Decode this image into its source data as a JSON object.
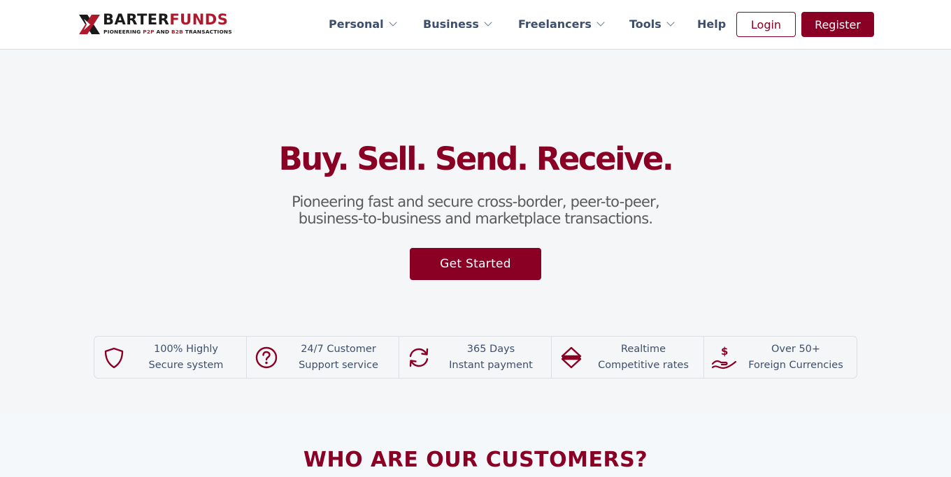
{
  "header": {
    "logo": {
      "word_part1": "BARTER",
      "word_part2": "FUNDS",
      "tagline_a": "PIONEERING ",
      "tagline_b": "P2P",
      "tagline_c": " AND ",
      "tagline_d": "B2B",
      "tagline_e": " TRANSACTIONS"
    },
    "nav": [
      {
        "label": "Personal",
        "has_dropdown": true
      },
      {
        "label": "Business",
        "has_dropdown": true
      },
      {
        "label": "Freelancers",
        "has_dropdown": true
      },
      {
        "label": "Tools",
        "has_dropdown": true
      },
      {
        "label": "Help",
        "has_dropdown": false
      }
    ],
    "login_label": "Login",
    "register_label": "Register"
  },
  "hero": {
    "title": "Buy. Sell. Send. Receive.",
    "subtitle_line1": "Pioneering fast and secure cross-border, peer-to-peer,",
    "subtitle_line2": "business-to-business and marketplace transactions.",
    "cta_label": "Get Started"
  },
  "features": [
    {
      "line1": "100% Highly",
      "line2": "Secure system",
      "icon": "shield-icon"
    },
    {
      "line1": "24/7 Customer",
      "line2": "Support service",
      "icon": "question-circle-icon"
    },
    {
      "line1": "365 Days",
      "line2": "Instant payment",
      "icon": "refresh-icon"
    },
    {
      "line1": "Realtime",
      "line2": "Competitive rates",
      "icon": "up-down-arrows-icon"
    },
    {
      "line1": "Over 50+",
      "line2": "Foreign Currencies",
      "icon": "money-hand-icon"
    }
  ],
  "section": {
    "title": "WHO ARE OUR CUSTOMERS?"
  },
  "colors": {
    "brand": "#8a0025",
    "logo_red": "#b0182c",
    "nav_text": "#3d4f6b",
    "page_bg": "#f5f6f8"
  }
}
